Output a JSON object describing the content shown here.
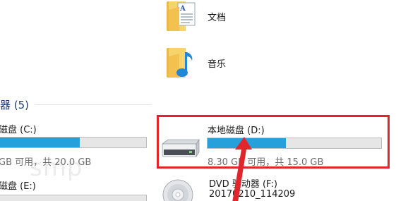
{
  "folders": [
    {
      "name": "文档",
      "icon": "documents-folder-icon"
    },
    {
      "name": "音乐",
      "icon": "music-folder-icon"
    }
  ],
  "section": {
    "title": "器 (5)"
  },
  "drives": {
    "c": {
      "name": "磁盘 (C:)",
      "capacity": "GB 可用，共 20.0 GB",
      "used_fraction": 0.55,
      "icon": "hard-drive-icon"
    },
    "d": {
      "name": "本地磁盘 (D:)",
      "capacity": "8.30 GB 可用，共 15.0 GB",
      "used_fraction": 0.45,
      "icon": "hard-drive-icon"
    },
    "e": {
      "name": "磁盘 (E:)",
      "used_fraction": 0.0,
      "icon": "hard-drive-icon"
    },
    "f": {
      "name": "DVD 驱动器 (F:)",
      "label": "20170210_114209",
      "icon": "dvd-drive-icon"
    }
  },
  "watermark": "smp",
  "colors": {
    "highlight_box": "#e0262b",
    "arrow": "#e0262b",
    "capacity_fill": "#26a0da",
    "capacity_track": "#e6e6e6",
    "section_title": "#1e3a6e"
  }
}
